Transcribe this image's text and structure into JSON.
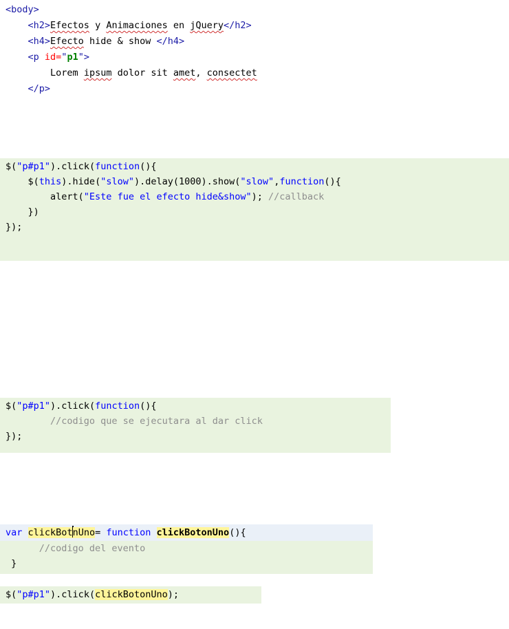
{
  "html_snippet": {
    "body_open": "<body>",
    "h2_open": "<h2>",
    "h2_w1": "Efectos",
    "h2_w2": " y ",
    "h2_w3": "Animaciones",
    "h2_w4": " en ",
    "h2_w5": "jQuery",
    "h2_close": "</h2>",
    "h4_open": "<h4>",
    "h4_w1": "Efecto",
    "h4_rest": " hide & show ",
    "h4_close": "</h4>",
    "p_open_a": "<p ",
    "p_attr": "id=",
    "p_q1": "\"",
    "p_id": "p1",
    "p_q2": "\"",
    "p_open_b": ">",
    "lorem_w1": "Lorem ",
    "lorem_w2": "ipsum",
    "lorem_w3": " dolor sit ",
    "lorem_w4": "amet",
    "lorem_w5": ", ",
    "lorem_w6": "consectet",
    "p_close": "</p>"
  },
  "code_hide_show": {
    "l1_a": "$(",
    "l1_str": "\"p#p1\"",
    "l1_b": ").click(",
    "l1_kw": "function",
    "l1_c": "(){",
    "l2_a": "    $(",
    "l2_kw": "this",
    "l2_b": ").hide(",
    "l2_str": "\"slow\"",
    "l2_c": ").delay(1000).show(",
    "l2_str2": "\"slow\"",
    "l2_d": ",",
    "l2_kw2": "function",
    "l2_e": "(){",
    "l3_a": "        alert(",
    "l3_str": "\"Este fue el efecto hide&show\"",
    "l3_b": "); ",
    "l3_cm": "//callback",
    "l4": "    })",
    "l5": "});"
  },
  "code_click": {
    "l1_a": "$(",
    "l1_str": "\"p#p1\"",
    "l1_b": ").click(",
    "l1_kw": "function",
    "l1_c": "(){",
    "l2_cm": "        //codigo que se ejecutara al dar click",
    "l3": "});"
  },
  "code_var": {
    "l1_kw": "var",
    "l1_sp": " ",
    "l1_name_a": "clickBot",
    "l1_name_b": "nUno",
    "l1_eq": "= ",
    "l1_kw2": "function",
    "l1_sp2": " ",
    "l1_fn": "clickBotonUno",
    "l1_end": "(){",
    "l2_cm": "      //codigo del evento",
    "l3": " }"
  },
  "code_call": {
    "l1_a": "$(",
    "l1_str": "\"p#p1\"",
    "l1_b": ").click(",
    "l1_arg": "clickBotonUno",
    "l1_c": ");"
  }
}
